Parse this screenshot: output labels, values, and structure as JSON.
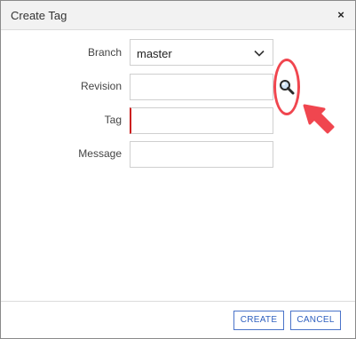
{
  "dialog": {
    "title": "Create Tag",
    "close_glyph": "×"
  },
  "form": {
    "branch": {
      "label": "Branch",
      "value": "master"
    },
    "revision": {
      "label": "Revision",
      "value": ""
    },
    "tag": {
      "label": "Tag",
      "value": ""
    },
    "message": {
      "label": "Message",
      "value": ""
    }
  },
  "icons": {
    "search": "search-icon",
    "chevron": "chevron-down-icon",
    "close": "close-icon"
  },
  "annotation": {
    "color": "#f0464f"
  },
  "footer": {
    "create_label": "CREATE",
    "cancel_label": "CANCEL"
  },
  "colors": {
    "accent": "#2e5fbf",
    "required": "#cc1f1f",
    "title_bar": "#f2f2f2"
  }
}
